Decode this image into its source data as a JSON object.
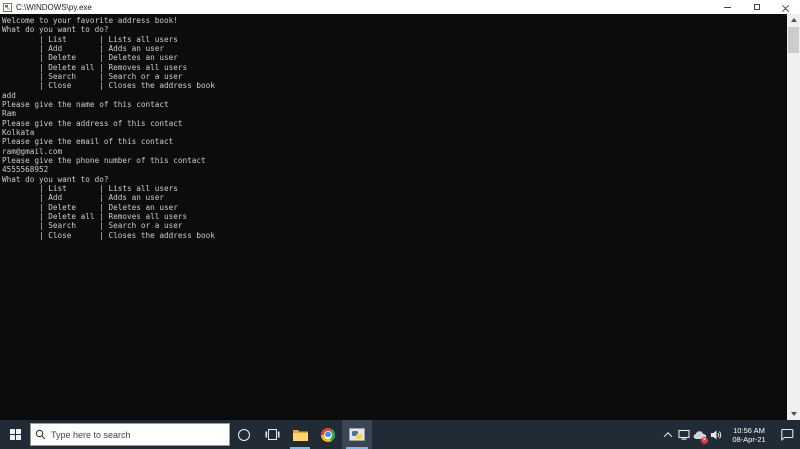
{
  "colors": {
    "console_background": "#0c0c0c",
    "console_text": "#cccccc",
    "titlebar_background": "#ffffff",
    "taskbar_background": "#212b36",
    "active_app_background": "#3a4653",
    "running_indicator": "#76b9ed",
    "scrollbar_track": "#f0f0f0",
    "scrollbar_thumb": "#cdcdcd"
  },
  "window": {
    "title": "C:\\WINDOWS\\py.exe"
  },
  "console": {
    "lines": [
      "Welcome to your favorite address book!",
      "What do you want to do?",
      "        | List       | Lists all users",
      "        | Add        | Adds an user",
      "        | Delete     | Deletes an user",
      "        | Delete all | Removes all users",
      "        | Search     | Search or a user",
      "        | Close      | Closes the address book",
      "add",
      "Please give the name of this contact",
      "Ram",
      "Please give the address of this contact",
      "Kolkata",
      "Please give the email of this contact",
      "ram@gmail.com",
      "Please give the phone number of this contact",
      "4555568952",
      "What do you want to do?",
      "        | List       | Lists all users",
      "        | Add        | Adds an user",
      "        | Delete     | Deletes an user",
      "        | Delete all | Removes all users",
      "        | Search     | Search or a user",
      "        | Close      | Closes the address book"
    ]
  },
  "taskbar": {
    "search": {
      "placeholder": "Type here to search"
    },
    "clock": {
      "time": "10:56 AM",
      "date": "08-Apr-21"
    }
  },
  "icons": {
    "app_icon": "py-console-window",
    "minimize": "thin-dash",
    "restore": "square-outline",
    "close": "x-cross",
    "start": "windows-logo-4-panes",
    "search": "magnifier",
    "cortana": "circle-outline",
    "task_view": "rect-with-side-panels",
    "file_explorer": "yellow-folder (running, blue underline)",
    "chrome": "chrome-color-wheel",
    "python_console": "gray-window-blue-yellow (active, highlighted)",
    "hidden_icons": "chevron-up",
    "network": "monitor-outline",
    "onedrive": "cloud-with-red-error-badge",
    "volume": "speaker-with-waves",
    "action_center": "speech-bubble-outline"
  }
}
